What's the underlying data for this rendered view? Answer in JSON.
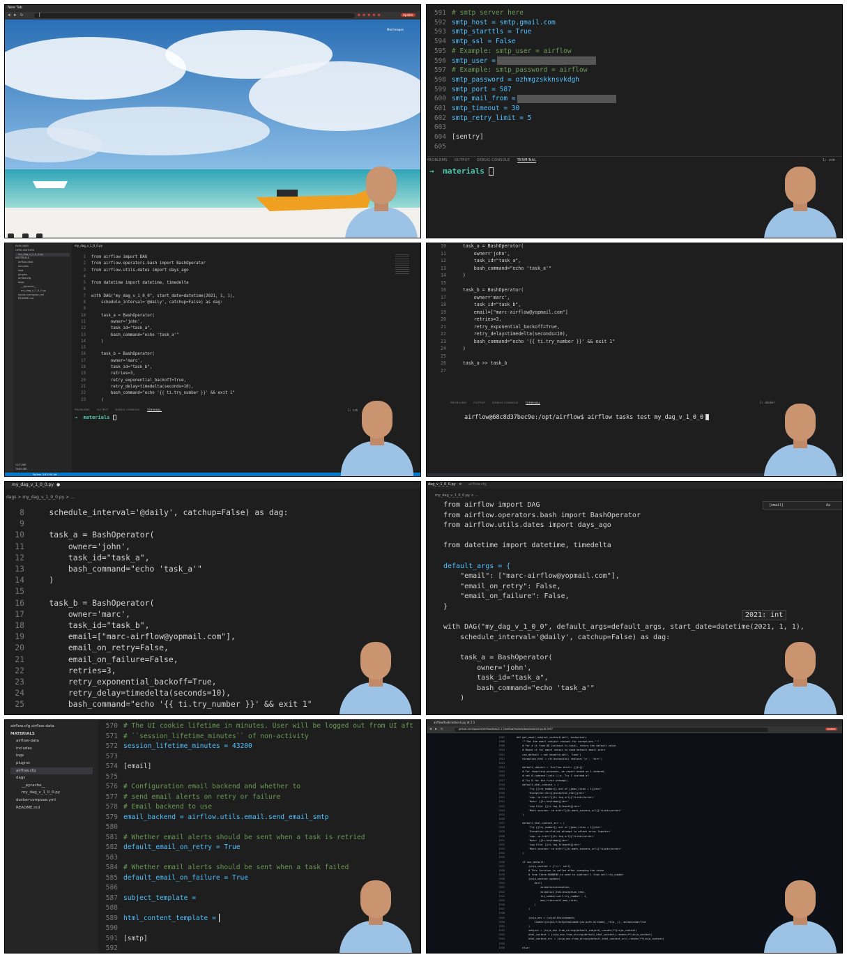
{
  "tile1": {
    "tab_title": "New Tab",
    "address": "|",
    "chrome_label": "Mail  Images",
    "update_label": "Update",
    "dock_label": "< ● >"
  },
  "tile2": {
    "lines": [
      {
        "n": "591",
        "t": "# smtp server here",
        "c": "cm"
      },
      {
        "n": "592",
        "t": "smtp_host = smtp.gmail.com",
        "c": ""
      },
      {
        "n": "593",
        "t": "smtp_starttls = True",
        "c": ""
      },
      {
        "n": "594",
        "t": "smtp_ssl = False",
        "c": ""
      },
      {
        "n": "595",
        "t": "# Example: smtp_user = airflow",
        "c": "cm"
      },
      {
        "n": "596",
        "t": "smtp_user =",
        "c": "",
        "redact": true
      },
      {
        "n": "597",
        "t": "# Example: smtp_password = airflow",
        "c": "cm"
      },
      {
        "n": "598",
        "t": "smtp_password = ozhmgzskknsvkdgh",
        "c": ""
      },
      {
        "n": "599",
        "t": "smtp_port = 587",
        "c": ""
      },
      {
        "n": "600",
        "t": "smtp_mail_from =",
        "c": "",
        "redact": true
      },
      {
        "n": "601",
        "t": "smtp_timeout = 30",
        "c": ""
      },
      {
        "n": "602",
        "t": "smtp_retry_limit = 5",
        "c": ""
      },
      {
        "n": "603",
        "t": "",
        "c": ""
      },
      {
        "n": "604",
        "t": "[sentry]",
        "c": ""
      },
      {
        "n": "605",
        "t": "",
        "c": ""
      }
    ],
    "panel_tabs": [
      "PROBLEMS",
      "OUTPUT",
      "DEBUG CONSOLE",
      "TERMINAL"
    ],
    "shell": "1: zsh",
    "prompt_arrow": "→",
    "prompt": "materials"
  },
  "tile3": {
    "tab": "my_dag_v_1_0_0.py",
    "explorer_title": "EXPLORER",
    "open_editors": "OPEN EDITORS",
    "root": "MATERIALS",
    "tree": [
      "airflow-data",
      "includes",
      "logs",
      "plugins",
      "airflow.cfg",
      "dags",
      "__pycache__",
      "my_dag_v_1_0_0.py",
      "docker-compose.yml",
      "README.md"
    ],
    "outline": "OUTLINE",
    "timeline": "TIMELINE",
    "lines": [
      {
        "n": "1",
        "t": "from airflow import DAG"
      },
      {
        "n": "2",
        "t": "from airflow.operators.bash import BashOperator"
      },
      {
        "n": "3",
        "t": "from airflow.utils.dates import days_ago"
      },
      {
        "n": "4",
        "t": ""
      },
      {
        "n": "5",
        "t": "from datetime import datetime, timedelta"
      },
      {
        "n": "6",
        "t": ""
      },
      {
        "n": "7",
        "t": "with DAG(\"my_dag_v_1_0_0\", start_date=datetime(2021, 1, 1),"
      },
      {
        "n": "8",
        "t": "    schedule_interval='@daily', catchup=False) as dag:"
      },
      {
        "n": "9",
        "t": ""
      },
      {
        "n": "10",
        "t": "    task_a = BashOperator("
      },
      {
        "n": "11",
        "t": "        owner='john',"
      },
      {
        "n": "12",
        "t": "        task_id=\"task_a\","
      },
      {
        "n": "13",
        "t": "        bash_command=\"echo 'task_a'\""
      },
      {
        "n": "14",
        "t": "    )"
      },
      {
        "n": "15",
        "t": ""
      },
      {
        "n": "16",
        "t": "    task_b = BashOperator("
      },
      {
        "n": "17",
        "t": "        owner='marc',"
      },
      {
        "n": "18",
        "t": "        task_id=\"task_b\","
      },
      {
        "n": "19",
        "t": "        retries=3,"
      },
      {
        "n": "20",
        "t": "        retry_exponential_backoff=True,"
      },
      {
        "n": "21",
        "t": "        retry_delay=timedelta(seconds=10),"
      },
      {
        "n": "22",
        "t": "        bash_command=\"echo '{{ ti.try_number }}' && exit 1\""
      },
      {
        "n": "23",
        "t": "    )"
      }
    ],
    "panel_tabs": [
      "PROBLEMS",
      "OUTPUT",
      "DEBUG CONSOLE",
      "TERMINAL"
    ],
    "shell": "1: zsh",
    "prompt_arrow": "→",
    "prompt": "materials",
    "status": "Python 3.8.5 64-bit"
  },
  "tile4": {
    "lines": [
      {
        "n": "10",
        "t": "    task_a = BashOperator("
      },
      {
        "n": "11",
        "t": "        owner='john',"
      },
      {
        "n": "12",
        "t": "        task_id=\"task_a\","
      },
      {
        "n": "13",
        "t": "        bash_command=\"echo 'task_a'\""
      },
      {
        "n": "14",
        "t": "    )"
      },
      {
        "n": "15",
        "t": ""
      },
      {
        "n": "16",
        "t": "    task_b = BashOperator("
      },
      {
        "n": "17",
        "t": "        owner='marc',"
      },
      {
        "n": "18",
        "t": "        task_id=\"task_b\","
      },
      {
        "n": "19",
        "t": "        email=[\"marc-airflow@yopmail.com\"]"
      },
      {
        "n": "20",
        "t": "        retries=3,"
      },
      {
        "n": "21",
        "t": "        retry_exponential_backoff=True,"
      },
      {
        "n": "22",
        "t": "        retry_delay=timedelta(seconds=10),"
      },
      {
        "n": "23",
        "t": "        bash_command=\"echo '{{ ti.try_number }}' && exit 1\""
      },
      {
        "n": "24",
        "t": "    )"
      },
      {
        "n": "25",
        "t": ""
      },
      {
        "n": "26",
        "t": "    task_a >> task_b"
      },
      {
        "n": "27",
        "t": ""
      }
    ],
    "panel_tabs": [
      "PROBLEMS",
      "OUTPUT",
      "DEBUG CONSOLE",
      "TERMINAL"
    ],
    "shell": "1: docker",
    "terminal": "airflow@68c8d37bec9e:/opt/airflow$ airflow tasks test my_dag_v_1_0_0"
  },
  "tile5": {
    "tab": "my_dag_v_1_0_0.py",
    "breadcrumb": "dags > my_dag_v_1_0_0.py > ...",
    "lines": [
      {
        "n": "8",
        "t": "    schedule_interval='@daily', catchup=False) as dag:"
      },
      {
        "n": "9",
        "t": ""
      },
      {
        "n": "10",
        "t": "    task_a = BashOperator("
      },
      {
        "n": "11",
        "t": "        owner='john',"
      },
      {
        "n": "12",
        "t": "        task_id=\"task_a\","
      },
      {
        "n": "13",
        "t": "        bash_command=\"echo 'task_a'\""
      },
      {
        "n": "14",
        "t": "    )"
      },
      {
        "n": "15",
        "t": ""
      },
      {
        "n": "16",
        "t": "    task_b = BashOperator("
      },
      {
        "n": "17",
        "t": "        owner='marc',"
      },
      {
        "n": "18",
        "t": "        task_id=\"task_b\","
      },
      {
        "n": "19",
        "t": "        email=[\"marc-airflow@yopmail.com\"],"
      },
      {
        "n": "20",
        "t": "        email_on_retry=False,"
      },
      {
        "n": "21",
        "t": "        email_on_failure=False,"
      },
      {
        "n": "22",
        "t": "        retries=3,"
      },
      {
        "n": "23",
        "t": "        retry_exponential_backoff=True,"
      },
      {
        "n": "24",
        "t": "        retry_delay=timedelta(seconds=10),"
      },
      {
        "n": "25",
        "t": "        bash_command=\"echo '{{ ti.try_number }}' && exit 1\""
      }
    ]
  },
  "tile6": {
    "tab": "dag_v_1_0_0.py",
    "tab2": "airflow.cfg",
    "breadcrumb": "my_dag_v_1_0_0.py > ...",
    "search": "[email]",
    "search_opts": "Aa",
    "hover": "2021: int",
    "lines": [
      {
        "n": "",
        "t": "from airflow import DAG"
      },
      {
        "n": "",
        "t": "from airflow.operators.bash import BashOperator"
      },
      {
        "n": "",
        "t": "from airflow.utils.dates import days_ago"
      },
      {
        "n": "",
        "t": ""
      },
      {
        "n": "",
        "t": "from datetime import datetime, timedelta"
      },
      {
        "n": "",
        "t": ""
      },
      {
        "n": "",
        "t": "default_args = {"
      },
      {
        "n": "",
        "t": "    \"email\": [\"marc-airflow@yopmail.com\"],"
      },
      {
        "n": "",
        "t": "    \"email_on_retry\": False,"
      },
      {
        "n": "",
        "t": "    \"email_on_failure\": False,"
      },
      {
        "n": "",
        "t": "}"
      },
      {
        "n": "",
        "t": ""
      },
      {
        "n": "",
        "t": "with DAG(\"my_dag_v_1_0_0\", default_args=default_args, start_date=datetime(2021, 1, 1),"
      },
      {
        "n": "",
        "t": "    schedule_interval='@daily', catchup=False) as dag:"
      },
      {
        "n": "",
        "t": ""
      },
      {
        "n": "",
        "t": "    task_a = BashOperator("
      },
      {
        "n": "",
        "t": "        owner='john',"
      },
      {
        "n": "",
        "t": "        task_id=\"task_a\","
      },
      {
        "n": "",
        "t": "        bash_command=\"echo 'task_a'\""
      },
      {
        "n": "",
        "t": "    )"
      }
    ]
  },
  "tile7": {
    "root": "MATERIALS",
    "tree": [
      "airflow-data",
      "includes",
      "logs",
      "plugins",
      "airflow.cfg",
      "dags",
      "__pycache__",
      "my_dag_v_1_0_0.py",
      "docker-compose.yml",
      "README.md"
    ],
    "tab": "airflow.cfg  airflow-data",
    "lines": [
      {
        "n": "570",
        "t": "# The UI cookie lifetime in minutes. User will be logged out from UI aft",
        "c": "cm"
      },
      {
        "n": "571",
        "t": "# ``session_lifetime_minutes`` of non-activity",
        "c": "cm"
      },
      {
        "n": "572",
        "t": "session_lifetime_minutes = 43200",
        "c": ""
      },
      {
        "n": "573",
        "t": "",
        "c": ""
      },
      {
        "n": "574",
        "t": "[email]",
        "c": ""
      },
      {
        "n": "575",
        "t": "",
        "c": ""
      },
      {
        "n": "576",
        "t": "# Configuration email backend and whether to",
        "c": "cm"
      },
      {
        "n": "577",
        "t": "# send email alerts on retry or failure",
        "c": "cm"
      },
      {
        "n": "578",
        "t": "# Email backend to use",
        "c": "cm"
      },
      {
        "n": "579",
        "t": "email_backend = airflow.utils.email.send_email_smtp",
        "c": ""
      },
      {
        "n": "580",
        "t": "",
        "c": ""
      },
      {
        "n": "581",
        "t": "# Whether email alerts should be sent when a task is retried",
        "c": "cm"
      },
      {
        "n": "582",
        "t": "default_email_on_retry = True",
        "c": ""
      },
      {
        "n": "583",
        "t": "",
        "c": ""
      },
      {
        "n": "584",
        "t": "# Whether email alerts should be sent when a task failed",
        "c": "cm"
      },
      {
        "n": "585",
        "t": "default_email_on_failure = True",
        "c": ""
      },
      {
        "n": "586",
        "t": "",
        "c": ""
      },
      {
        "n": "587",
        "t": "subject_template =",
        "c": ""
      },
      {
        "n": "588",
        "t": "",
        "c": ""
      },
      {
        "n": "589",
        "t": "html_content_template =",
        "c": "",
        "cursor": true
      },
      {
        "n": "590",
        "t": "",
        "c": ""
      },
      {
        "n": "591",
        "t": "[smtp]",
        "c": ""
      },
      {
        "n": "592",
        "t": "",
        "c": ""
      }
    ]
  },
  "tile8": {
    "tab": "airflow/taskinstance.py at 2.1",
    "address": "github.com/apache/airflow/blob/2.1.2/airflow/models/taskinstance.py#L1907",
    "update_label": "Update",
    "lines": [
      {
        "n": "1907",
        "t": "    def get_email_subject_content(self, exception):"
      },
      {
        "n": "1908",
        "t": "        \"\"\"Get the email subject content for exceptions.\"\"\""
      },
      {
        "n": "1909",
        "t": "        # For a ti from DB (without ti.task), return the default value"
      },
      {
        "n": "1910",
        "t": "        # Reuse it for smart sensor to send default email alert"
      },
      {
        "n": "1911",
        "t": "        use_default = not hasattr(self, 'task')"
      },
      {
        "n": "1912",
        "t": "        exception_html = str(exception).replace('\\n', '<br>')"
      },
      {
        "n": "1913",
        "t": ""
      },
      {
        "n": "1914",
        "t": "        default_subject = 'Airflow alert: {{ti}}'"
      },
      {
        "n": "1915",
        "t": "        # For reporting purposes, we report based on 1-indexed,"
      },
      {
        "n": "1916",
        "t": "        # not 0-indexed lists (i.e. Try 1 instead of"
      },
      {
        "n": "1917",
        "t": "        # Try 0 for the first attempt)."
      },
      {
        "n": "1918",
        "t": "        default_html_content = ("
      },
      {
        "n": "1919",
        "t": "            'Try {{try_number}} out of {{max_tries + 1}}<br>'"
      },
      {
        "n": "1920",
        "t": "            'Exception:<br>{{exception_html}}<br>'"
      },
      {
        "n": "1921",
        "t": "            'Log: <a href=\"{{ti.log_url}}\">Link</a><br>'"
      },
      {
        "n": "1922",
        "t": "            'Host: {{ti.hostname}}<br>'"
      },
      {
        "n": "1923",
        "t": "            'Log file: {{ti.log_filepath}}<br>'"
      },
      {
        "n": "1924",
        "t": "            'Mark success: <a href=\"{{ti.mark_success_url}}\">Link</a><br>'"
      },
      {
        "n": "1925",
        "t": "        )"
      },
      {
        "n": "1926",
        "t": ""
      },
      {
        "n": "1927",
        "t": "        default_html_content_err = ("
      },
      {
        "n": "1928",
        "t": "            'Try {{try_number}} out of {{max_tries + 1}}<br>'"
      },
      {
        "n": "1929",
        "t": "            'Exception:<br>Failed attempt to attach error logs<br>'"
      },
      {
        "n": "1930",
        "t": "            'Log: <a href=\"{{ti.log_url}}\">Link</a><br>'"
      },
      {
        "n": "1931",
        "t": "            'Host: {{ti.hostname}}<br>'"
      },
      {
        "n": "1932",
        "t": "            'Log file: {{ti.log_filepath}}<br>'"
      },
      {
        "n": "1933",
        "t": "            'Mark success: <a href=\"{{ti.mark_success_url}}\">Link</a><br>'"
      },
      {
        "n": "1934",
        "t": "        )"
      },
      {
        "n": "1935",
        "t": ""
      },
      {
        "n": "1936",
        "t": "        if use_default:"
      },
      {
        "n": "1937",
        "t": "            jinja_context = {'ti': self}"
      },
      {
        "n": "1938",
        "t": "            # This function is called after changing the state"
      },
      {
        "n": "1939",
        "t": "            # from State.RUNNING so need to subtract 1 from self.try_number"
      },
      {
        "n": "1940",
        "t": "            jinja_context.update("
      },
      {
        "n": "1941",
        "t": "                dict("
      },
      {
        "n": "1942",
        "t": "                    exception=exception,"
      },
      {
        "n": "1943",
        "t": "                    exception_html=exception_html,"
      },
      {
        "n": "1944",
        "t": "                    try_number=self.try_number - 1,"
      },
      {
        "n": "1945",
        "t": "                    max_tries=self.max_tries,"
      },
      {
        "n": "1946",
        "t": "                )"
      },
      {
        "n": "1947",
        "t": "            )"
      },
      {
        "n": "1948",
        "t": ""
      },
      {
        "n": "1949",
        "t": "            jinja_env = jinja2.Environment("
      },
      {
        "n": "1950",
        "t": "                loader=jinja2.FileSystemLoader(os.path.dirname(__file__)), autoescape=True"
      },
      {
        "n": "1951",
        "t": "            )"
      },
      {
        "n": "1952",
        "t": "            subject = jinja_env.from_string(default_subject).render(**jinja_context)"
      },
      {
        "n": "1953",
        "t": "            html_content = jinja_env.from_string(default_html_content).render(**jinja_context)"
      },
      {
        "n": "1954",
        "t": "            html_content_err = jinja_env.from_string(default_html_content_err).render(**jinja_context)"
      },
      {
        "n": "1955",
        "t": ""
      },
      {
        "n": "1956",
        "t": "        else:"
      }
    ]
  },
  "colors": {
    "editor_bg": "#1e1e1e",
    "comment": "#6a9955",
    "keyword": "#c586c0",
    "string": "#ce9178",
    "variable": "#4fc1ff",
    "prompt": "#4ec9b0",
    "shirt": "#9cc3e6"
  }
}
